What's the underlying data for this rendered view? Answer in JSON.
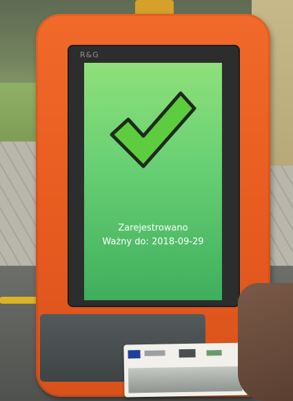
{
  "device": {
    "brand": "R&G"
  },
  "screen": {
    "status_icon": "checkmark-icon",
    "line1": "Zarejestrowano",
    "line2": "Ważny do: 2018-09-29",
    "colors": {
      "screen_top": "#8ee07a",
      "screen_bottom": "#3fae5d",
      "check_fill": "#5dcc3f",
      "device_orange": "#e85c20"
    }
  }
}
